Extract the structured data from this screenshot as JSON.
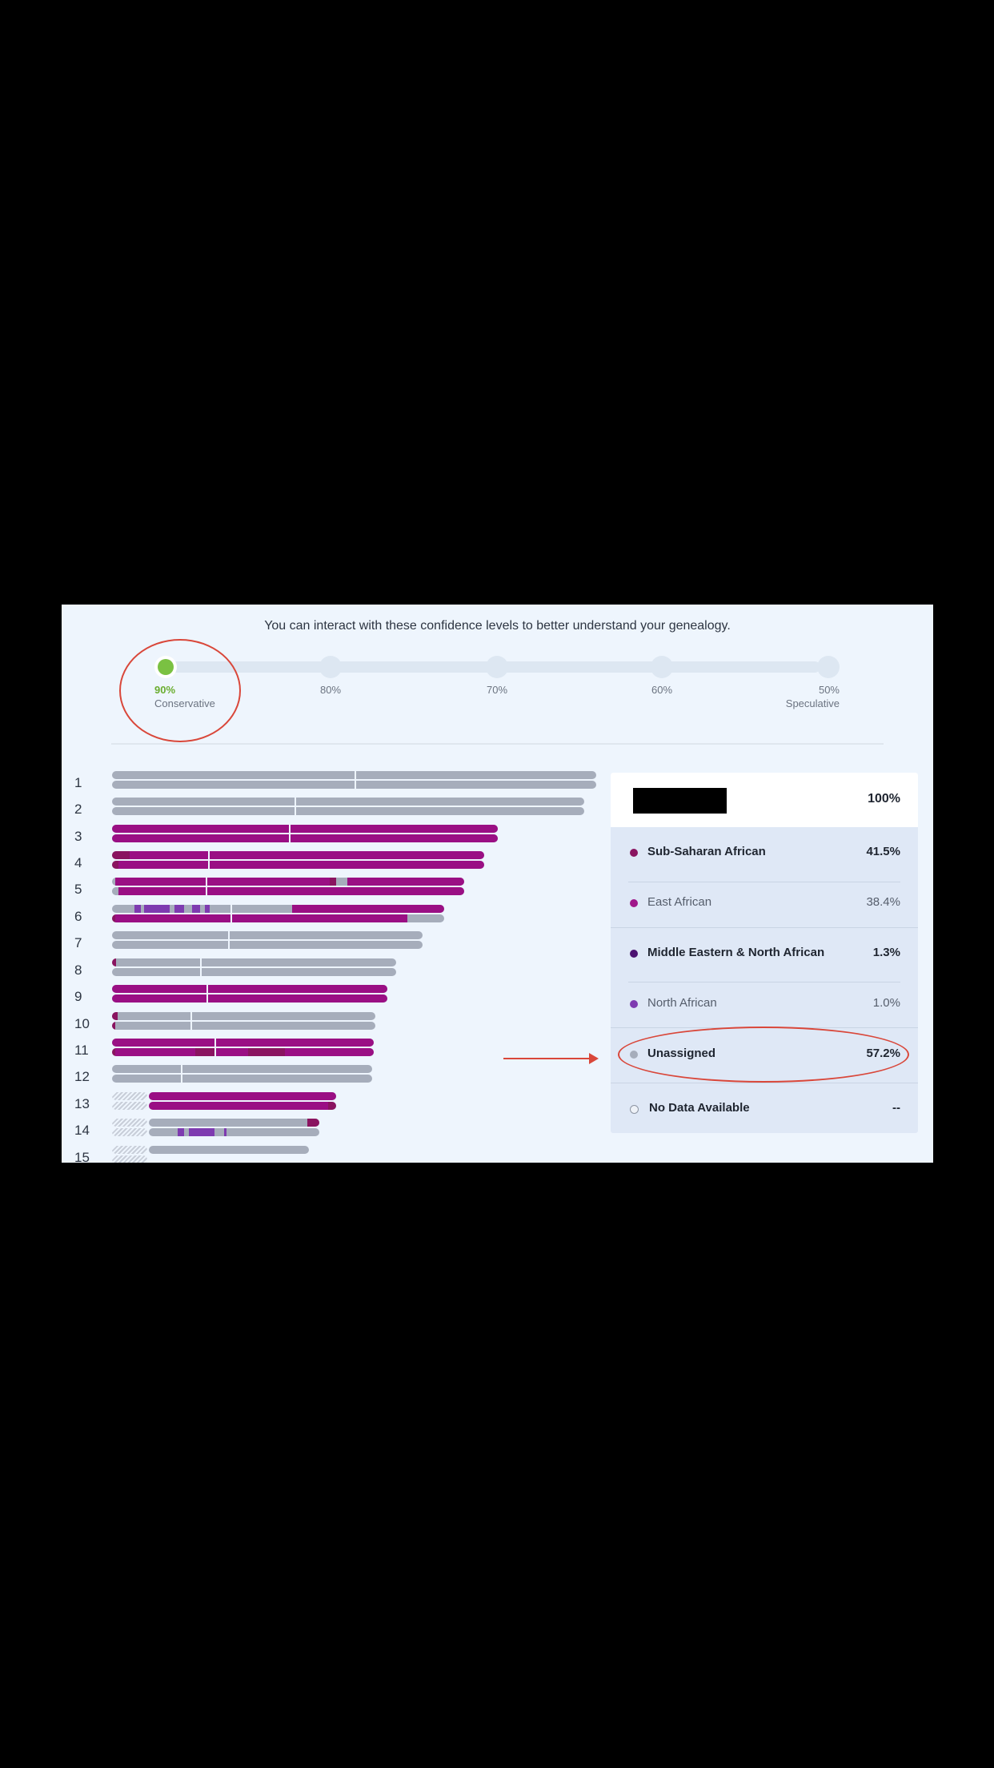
{
  "instruction": "You can interact with these confidence levels to better understand your genealogy.",
  "confidence_slider": {
    "levels": [
      {
        "pct": "90%",
        "label": "Conservative",
        "active": true
      },
      {
        "pct": "80%",
        "label": "",
        "active": false
      },
      {
        "pct": "70%",
        "label": "",
        "active": false
      },
      {
        "pct": "60%",
        "label": "",
        "active": false
      },
      {
        "pct": "50%",
        "label": "Speculative",
        "active": false
      }
    ],
    "active_color": "#7ac142"
  },
  "chromosomes": [
    "1",
    "2",
    "3",
    "4",
    "5",
    "6",
    "7",
    "8",
    "9",
    "10",
    "11",
    "12",
    "13",
    "14",
    "15"
  ],
  "legend": {
    "total_value": "100%",
    "rows": [
      {
        "name": "Sub-Saharan African",
        "value": "41.5%",
        "color": "#8a1460",
        "bold": true
      },
      {
        "name": "East African",
        "value": "38.4%",
        "color": "#a0178a",
        "bold": false
      },
      {
        "name": "Middle Eastern & North African",
        "value": "1.3%",
        "color": "#4b1170",
        "bold": true
      },
      {
        "name": "North African",
        "value": "1.0%",
        "color": "#7e3bb0",
        "bold": false
      },
      {
        "name": "Unassigned",
        "value": "57.2%",
        "color": "#a6adbb",
        "bold": true
      },
      {
        "name": "No Data Available",
        "value": "--",
        "color": "none",
        "bold": true
      }
    ]
  },
  "colors": {
    "east_african": "#9a0f84",
    "sub_saharan": "#8a1460",
    "north_african": "#7e3bb0",
    "unassigned": "#a6adbb",
    "annotation": "#d9473a",
    "panel_bg": "#eef5fd"
  }
}
